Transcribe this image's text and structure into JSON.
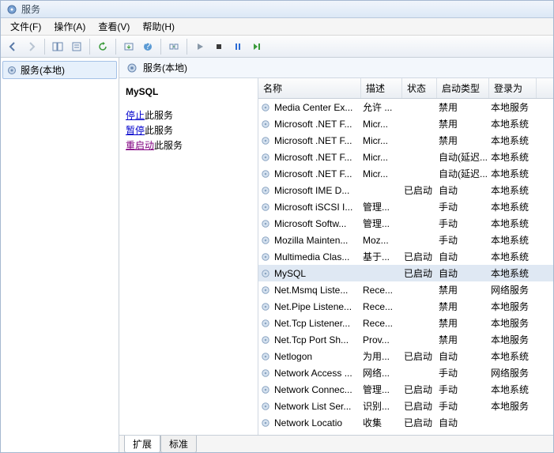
{
  "window": {
    "title": "服务"
  },
  "menu": {
    "file": "文件(F)",
    "action": "操作(A)",
    "view": "查看(V)",
    "help": "帮助(H)"
  },
  "tree": {
    "root": "服务(本地)"
  },
  "subheader": {
    "label": "服务(本地)"
  },
  "detail": {
    "title": "MySQL",
    "stop_link": "停止",
    "stop_tail": "此服务",
    "pause_link": "暂停",
    "pause_tail": "此服务",
    "restart_link": "重启动",
    "restart_tail": "此服务"
  },
  "columns": {
    "name": "名称",
    "desc": "描述",
    "status": "状态",
    "startup": "启动类型",
    "logon": "登录为"
  },
  "services": [
    {
      "name": "Media Center Ex...",
      "desc": "允许 ...",
      "status": "",
      "startup": "禁用",
      "logon": "本地服务",
      "selected": false
    },
    {
      "name": "Microsoft .NET F...",
      "desc": "Micr...",
      "status": "",
      "startup": "禁用",
      "logon": "本地系统",
      "selected": false
    },
    {
      "name": "Microsoft .NET F...",
      "desc": "Micr...",
      "status": "",
      "startup": "禁用",
      "logon": "本地系统",
      "selected": false
    },
    {
      "name": "Microsoft .NET F...",
      "desc": "Micr...",
      "status": "",
      "startup": "自动(延迟...",
      "logon": "本地系统",
      "selected": false
    },
    {
      "name": "Microsoft .NET F...",
      "desc": "Micr...",
      "status": "",
      "startup": "自动(延迟...",
      "logon": "本地系统",
      "selected": false
    },
    {
      "name": "Microsoft IME D...",
      "desc": "",
      "status": "已启动",
      "startup": "自动",
      "logon": "本地系统",
      "selected": false
    },
    {
      "name": "Microsoft iSCSI I...",
      "desc": "管理...",
      "status": "",
      "startup": "手动",
      "logon": "本地系统",
      "selected": false
    },
    {
      "name": "Microsoft Softw...",
      "desc": "管理...",
      "status": "",
      "startup": "手动",
      "logon": "本地系统",
      "selected": false
    },
    {
      "name": "Mozilla Mainten...",
      "desc": "Moz...",
      "status": "",
      "startup": "手动",
      "logon": "本地系统",
      "selected": false
    },
    {
      "name": "Multimedia Clas...",
      "desc": "基于...",
      "status": "已启动",
      "startup": "自动",
      "logon": "本地系统",
      "selected": false
    },
    {
      "name": "MySQL",
      "desc": "",
      "status": "已启动",
      "startup": "自动",
      "logon": "本地系统",
      "selected": true
    },
    {
      "name": "Net.Msmq Liste...",
      "desc": "Rece...",
      "status": "",
      "startup": "禁用",
      "logon": "网络服务",
      "selected": false
    },
    {
      "name": "Net.Pipe Listene...",
      "desc": "Rece...",
      "status": "",
      "startup": "禁用",
      "logon": "本地服务",
      "selected": false
    },
    {
      "name": "Net.Tcp Listener...",
      "desc": "Rece...",
      "status": "",
      "startup": "禁用",
      "logon": "本地服务",
      "selected": false
    },
    {
      "name": "Net.Tcp Port Sh...",
      "desc": "Prov...",
      "status": "",
      "startup": "禁用",
      "logon": "本地服务",
      "selected": false
    },
    {
      "name": "Netlogon",
      "desc": "为用...",
      "status": "已启动",
      "startup": "自动",
      "logon": "本地系统",
      "selected": false
    },
    {
      "name": "Network Access ...",
      "desc": "网络...",
      "status": "",
      "startup": "手动",
      "logon": "网络服务",
      "selected": false
    },
    {
      "name": "Network Connec...",
      "desc": "管理...",
      "status": "已启动",
      "startup": "手动",
      "logon": "本地系统",
      "selected": false
    },
    {
      "name": "Network List Ser...",
      "desc": "识别...",
      "status": "已启动",
      "startup": "手动",
      "logon": "本地服务",
      "selected": false
    },
    {
      "name": "Network Locatio",
      "desc": "收集",
      "status": "已启动",
      "startup": "自动",
      "logon": "",
      "selected": false
    }
  ],
  "tabs": {
    "extended": "扩展",
    "standard": "标准"
  }
}
